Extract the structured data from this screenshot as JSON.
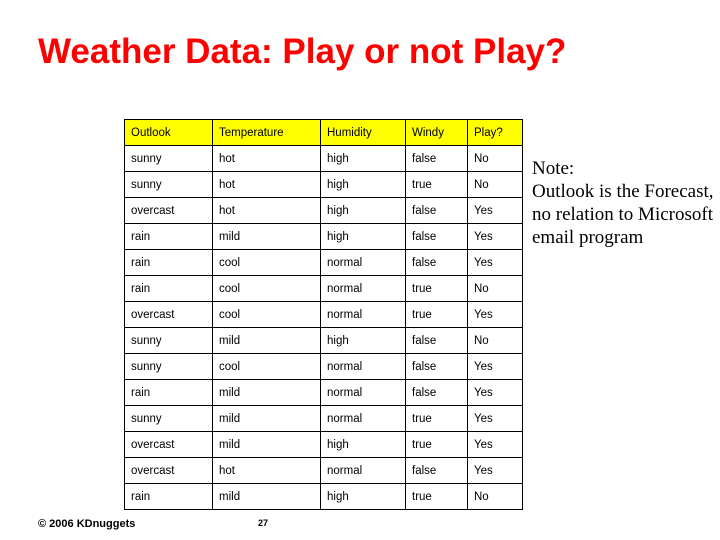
{
  "slide": {
    "title": "Weather Data: Play or not Play?",
    "note": "Note:\nOutlook is the Forecast,\nno relation to Microsoft email program",
    "footer_copyright": "© 2006 KDnuggets",
    "page_number": "27"
  },
  "table": {
    "headers": [
      "Outlook",
      "Temperature",
      "Humidity",
      "Windy",
      "Play?"
    ],
    "rows": [
      [
        "sunny",
        "hot",
        "high",
        "false",
        "No"
      ],
      [
        "sunny",
        "hot",
        "high",
        "true",
        "No"
      ],
      [
        "overcast",
        "hot",
        "high",
        "false",
        "Yes"
      ],
      [
        "rain",
        "mild",
        "high",
        "false",
        "Yes"
      ],
      [
        "rain",
        "cool",
        "normal",
        "false",
        "Yes"
      ],
      [
        "rain",
        "cool",
        "normal",
        "true",
        "No"
      ],
      [
        "overcast",
        "cool",
        "normal",
        "true",
        "Yes"
      ],
      [
        "sunny",
        "mild",
        "high",
        "false",
        "No"
      ],
      [
        "sunny",
        "cool",
        "normal",
        "false",
        "Yes"
      ],
      [
        "rain",
        "mild",
        "normal",
        "false",
        "Yes"
      ],
      [
        "sunny",
        "mild",
        "normal",
        "true",
        "Yes"
      ],
      [
        "overcast",
        "mild",
        "high",
        "true",
        "Yes"
      ],
      [
        "overcast",
        "hot",
        "normal",
        "false",
        "Yes"
      ],
      [
        "rain",
        "mild",
        "high",
        "true",
        "No"
      ]
    ]
  },
  "colors": {
    "title": "#ff0000",
    "header_background": "#ffff00",
    "text": "#000000",
    "background": "#ffffff"
  }
}
